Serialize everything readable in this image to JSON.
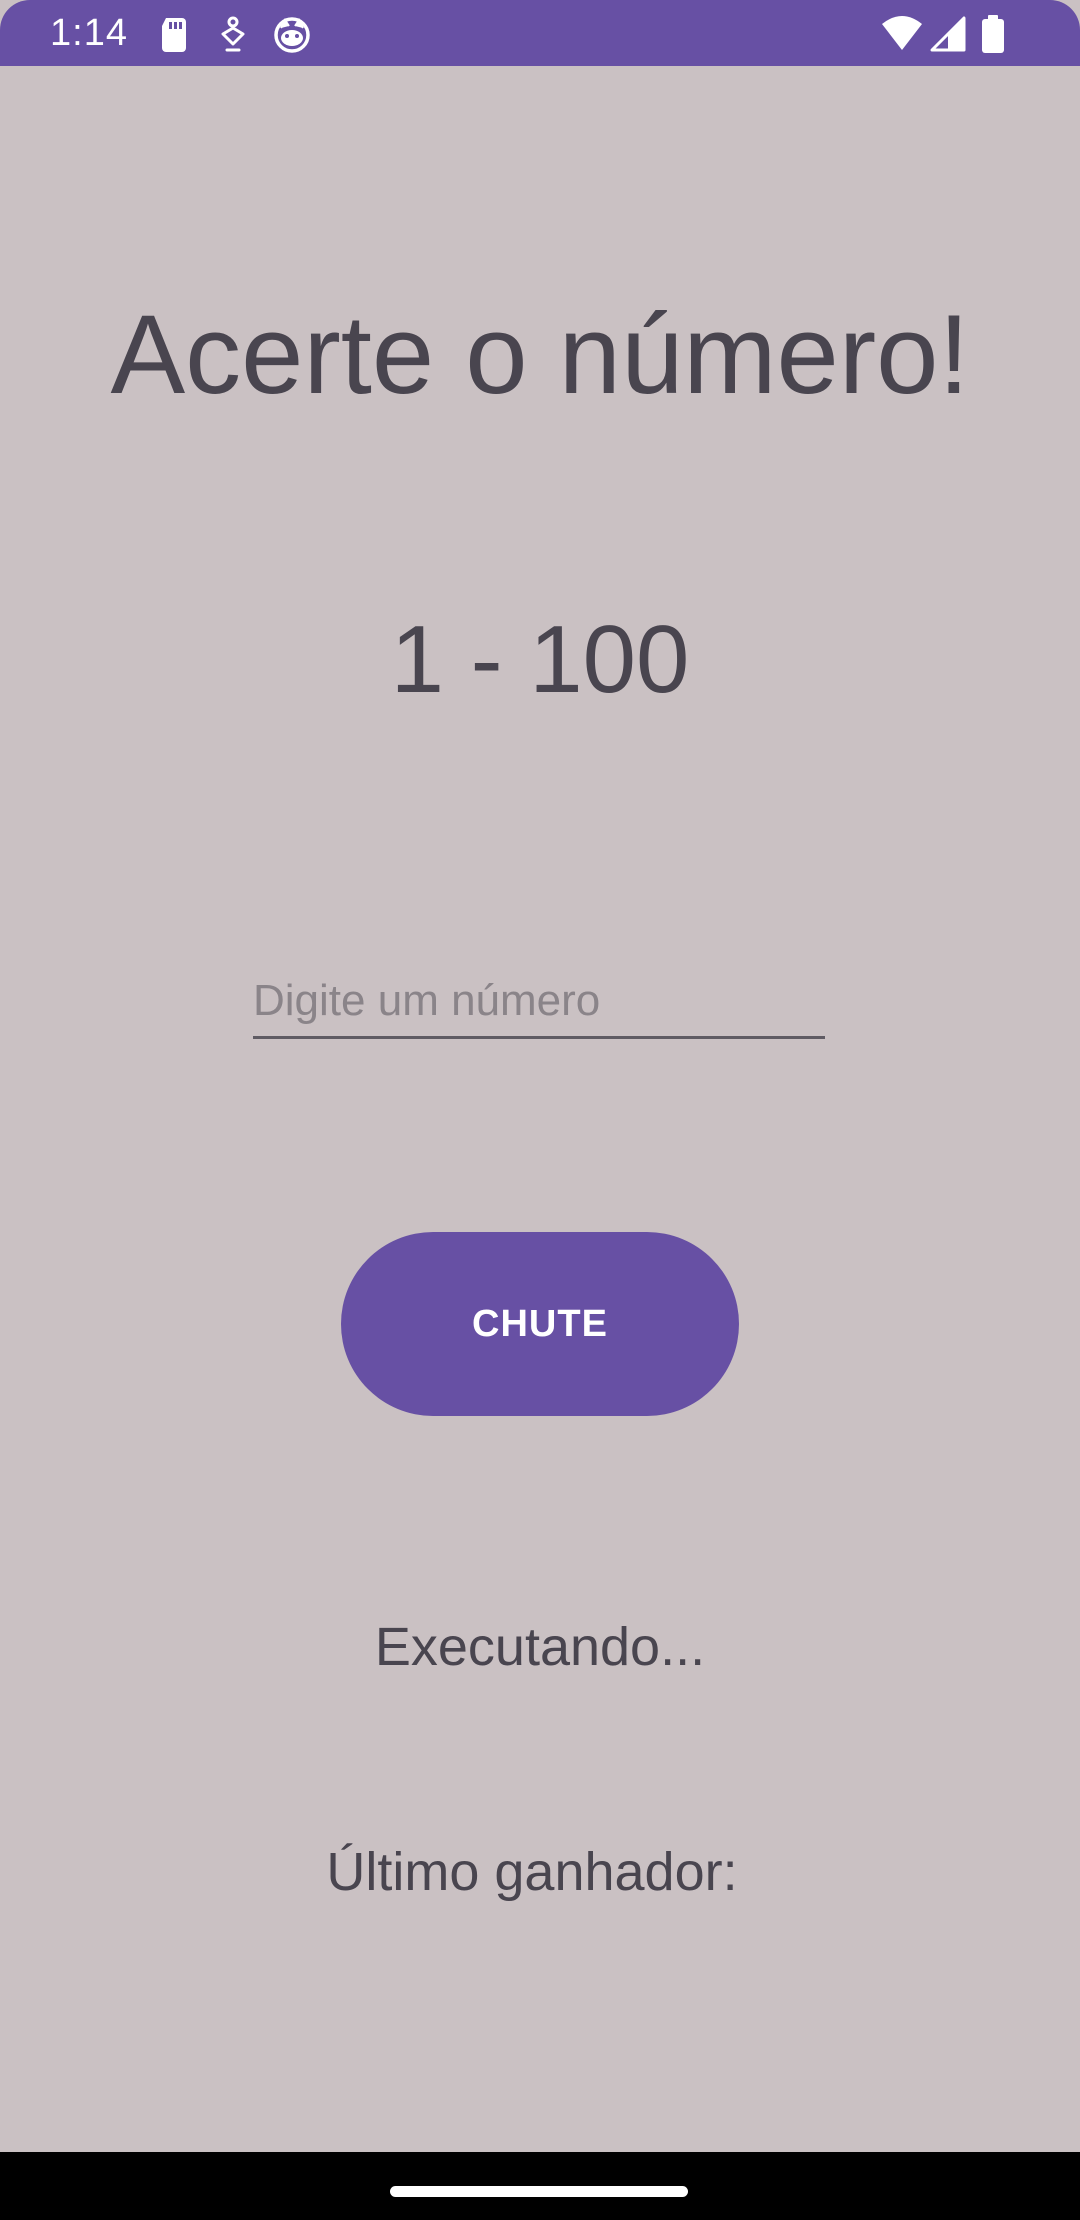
{
  "status_bar": {
    "time": "1:14",
    "left_icons": [
      "sd-card-icon",
      "accessibility-icon",
      "cat-face-icon"
    ],
    "right_icons": [
      "wifi-icon",
      "cellular-signal-icon",
      "battery-icon"
    ],
    "color": "#6750a4"
  },
  "main": {
    "title": "Acerte o número!",
    "range": "1 - 100",
    "input": {
      "placeholder": "Digite um número",
      "value": ""
    },
    "button_label": "CHUTE",
    "status": "Executando...",
    "winner_label": "Último ganhador:"
  },
  "colors": {
    "accent": "#6750a4",
    "background": "#cac1c3",
    "text": "#49454f"
  }
}
